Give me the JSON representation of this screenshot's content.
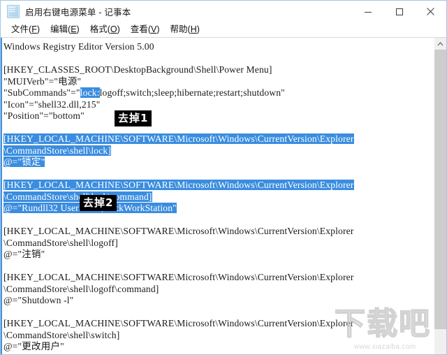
{
  "window": {
    "title": "启用右键电源菜单 - 记事本",
    "icon": "notepad-icon",
    "buttons": {
      "minimize": "minimize-icon",
      "maximize": "maximize-icon",
      "close": "close-icon"
    }
  },
  "menubar": {
    "items": [
      {
        "label": "文件",
        "mnemonic": "F"
      },
      {
        "label": "编辑",
        "mnemonic": "E"
      },
      {
        "label": "格式",
        "mnemonic": "O"
      },
      {
        "label": "查看",
        "mnemonic": "V"
      },
      {
        "label": "帮助",
        "mnemonic": "H"
      }
    ]
  },
  "editor": {
    "lines": [
      {
        "id": "l1",
        "text": "Windows Registry Editor Version 5.00",
        "selected": false
      },
      {
        "id": "l2",
        "text": "",
        "selected": false
      },
      {
        "id": "l3",
        "text": "[HKEY_CLASSES_ROOT\\DesktopBackground\\Shell\\Power Menu]",
        "selected": false
      },
      {
        "id": "l4",
        "text": "\"MUIVerb\"=\"电源\"",
        "selected": false
      },
      {
        "id": "l5",
        "pre": "\"SubCommands\"=\"",
        "highlight": "lock:",
        "post": "logoff;switch;sleep;hibernate;restart;shutdown\"",
        "selected": false
      },
      {
        "id": "l6",
        "text": "\"Icon\"=\"shell32.dll,215\"",
        "selected": false
      },
      {
        "id": "l7",
        "text": "\"Position\"=\"bottom\"",
        "selected": false
      },
      {
        "id": "l8",
        "text": "",
        "selected": false
      },
      {
        "id": "l9",
        "text": "[HKEY_LOCAL_MACHINE\\SOFTWARE\\Microsoft\\Windows\\CurrentVersion\\Explorer",
        "selected": true
      },
      {
        "id": "l10",
        "text": "\\CommandStore\\shell\\lock]",
        "selected": true
      },
      {
        "id": "l11",
        "text": "@=\"锁定\"",
        "selected": true
      },
      {
        "id": "l12",
        "text": "",
        "selected": false
      },
      {
        "id": "l13",
        "text": "[HKEY_LOCAL_MACHINE\\SOFTWARE\\Microsoft\\Windows\\CurrentVersion\\Explorer",
        "selected": true
      },
      {
        "id": "l14",
        "text": "\\CommandStore\\shell\\lock\\command]",
        "selected": true
      },
      {
        "id": "l15",
        "text": "@=\"Rundll32 User32.dll,LockWorkStation\"",
        "selected": true
      },
      {
        "id": "l16",
        "text": "",
        "selected": false
      },
      {
        "id": "l17",
        "text": "[HKEY_LOCAL_MACHINE\\SOFTWARE\\Microsoft\\Windows\\CurrentVersion\\Explorer",
        "selected": false
      },
      {
        "id": "l18",
        "text": "\\CommandStore\\shell\\logoff]",
        "selected": false
      },
      {
        "id": "l19",
        "text": "@=\"注销\"",
        "selected": false
      },
      {
        "id": "l20",
        "text": "",
        "selected": false
      },
      {
        "id": "l21",
        "text": "[HKEY_LOCAL_MACHINE\\SOFTWARE\\Microsoft\\Windows\\CurrentVersion\\Explorer",
        "selected": false
      },
      {
        "id": "l22",
        "text": "\\CommandStore\\shell\\logoff\\command]",
        "selected": false
      },
      {
        "id": "l23",
        "text": "@=\"Shutdown -l\"",
        "selected": false
      },
      {
        "id": "l24",
        "text": "",
        "selected": false
      },
      {
        "id": "l25",
        "text": "[HKEY_LOCAL_MACHINE\\SOFTWARE\\Microsoft\\Windows\\CurrentVersion\\Explorer",
        "selected": false
      },
      {
        "id": "l26",
        "text": "\\CommandStore\\shell\\switch]",
        "selected": false
      },
      {
        "id": "l27",
        "text": "@=\"更改用户\"",
        "selected": false
      }
    ]
  },
  "annotations": [
    {
      "id": "callout1",
      "label": "去掉1"
    },
    {
      "id": "callout2",
      "label": "去掉2"
    }
  ],
  "scrollbar": {
    "up_arrow": "chevron-up-icon"
  },
  "watermark": {
    "chars": "下载吧",
    "url": "www.xiazaiba.com"
  },
  "colors": {
    "selection": "#3a8ddf",
    "window_border": "#9fc8e8",
    "callout_bg": "#000000",
    "scrollbar_thumb": "#cdcdcd"
  }
}
